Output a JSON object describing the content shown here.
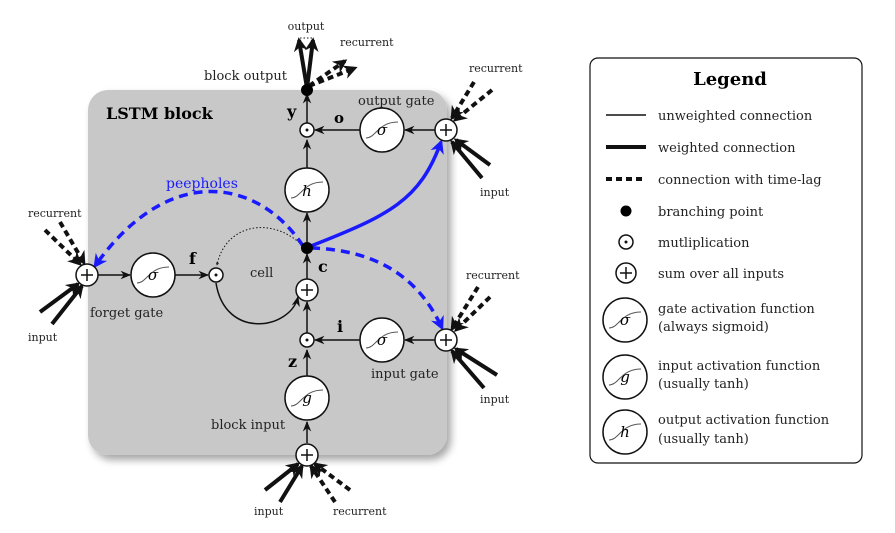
{
  "diagram": {
    "block_title": "LSTM block",
    "labels": {
      "output": "output",
      "recurrent_top": "recurrent",
      "block_output": "block output",
      "y": "y",
      "o": "o",
      "output_gate": "output gate",
      "peepholes": "peepholes",
      "f": "f",
      "cell": "cell",
      "c": "c",
      "forget_gate": "forget gate",
      "i": "i",
      "input_gate": "input gate",
      "z": "z",
      "block_input": "block input",
      "input": "input",
      "recurrent": "recurrent"
    },
    "symbols": {
      "sigma": "σ",
      "g": "g",
      "h": "h",
      "mult": "·",
      "plus": "+"
    },
    "peephole_color": "#1a1aff"
  },
  "legend": {
    "title": "Legend",
    "items": [
      {
        "symbol": "thin-line",
        "label": "unweighted connection"
      },
      {
        "symbol": "thick-line",
        "label": "weighted connection"
      },
      {
        "symbol": "dashed-line",
        "label": "connection with time-lag"
      },
      {
        "symbol": "filled-dot",
        "label": "branching point"
      },
      {
        "symbol": "circle-dot",
        "label": "mutliplication"
      },
      {
        "symbol": "circle-plus",
        "label": "sum over all inputs"
      },
      {
        "symbol": "sigma-circle",
        "label": "gate activation function",
        "label2": "(always sigmoid)"
      },
      {
        "symbol": "g-circle",
        "label": "input activation function",
        "label2": "(usually tanh)"
      },
      {
        "symbol": "h-circle",
        "label": "output activation function",
        "label2": "(usually tanh)"
      }
    ]
  }
}
